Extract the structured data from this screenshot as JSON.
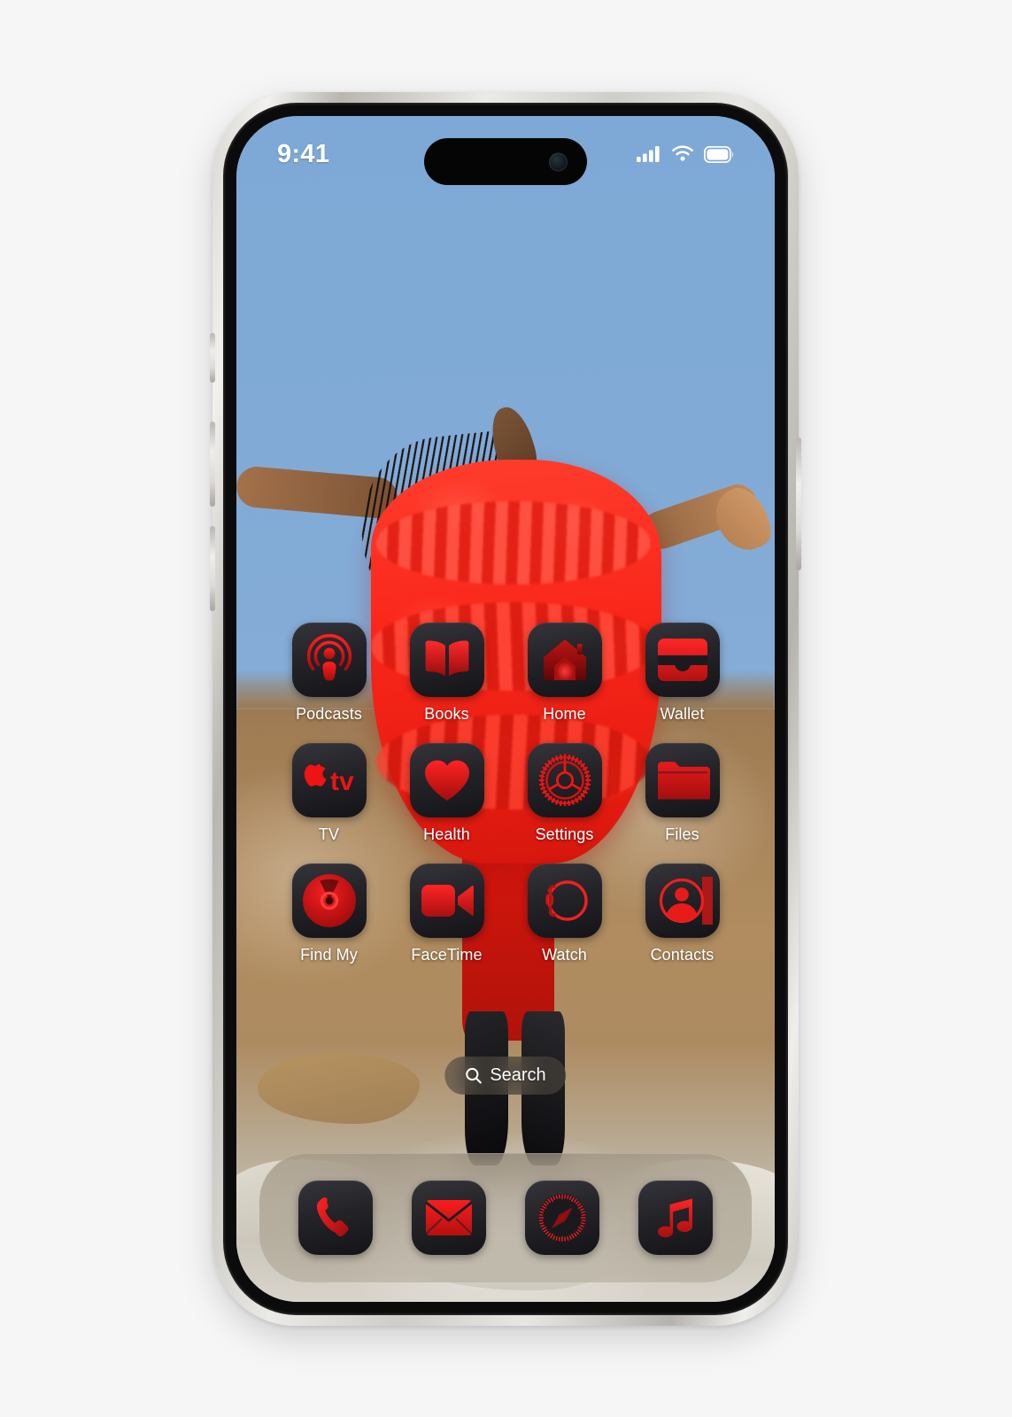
{
  "device": {
    "name": "iPhone",
    "frame_color": "#d8d6d2",
    "screen_background": "#7ba7d7"
  },
  "status_bar": {
    "time": "9:41",
    "signal_icon": "cellular-signal-icon",
    "signal_bars": 4,
    "wifi_icon": "wifi-icon",
    "battery_icon": "battery-icon",
    "battery_full": true,
    "dynamic_island": "dynamic-island",
    "camera_icon": "front-camera-icon"
  },
  "theme": {
    "accent_red": "#ee1111",
    "icon_dark": "#1d1d22",
    "label_color": "#ffffff"
  },
  "home_screen": {
    "rows": [
      [
        {
          "label": "Podcasts",
          "icon": "podcasts-icon"
        },
        {
          "label": "Books",
          "icon": "books-icon"
        },
        {
          "label": "Home",
          "icon": "home-icon"
        },
        {
          "label": "Wallet",
          "icon": "wallet-icon"
        }
      ],
      [
        {
          "label": "TV",
          "icon": "apple-tv-icon"
        },
        {
          "label": "Health",
          "icon": "health-icon"
        },
        {
          "label": "Settings",
          "icon": "settings-icon"
        },
        {
          "label": "Files",
          "icon": "files-icon"
        }
      ],
      [
        {
          "label": "Find My",
          "icon": "find-my-icon"
        },
        {
          "label": "FaceTime",
          "icon": "facetime-icon"
        },
        {
          "label": "Watch",
          "icon": "watch-icon"
        },
        {
          "label": "Contacts",
          "icon": "contacts-icon"
        }
      ]
    ]
  },
  "search": {
    "label": "Search",
    "icon": "search-icon"
  },
  "dock": {
    "items": [
      {
        "label": "Phone",
        "icon": "phone-icon"
      },
      {
        "label": "Mail",
        "icon": "mail-icon"
      },
      {
        "label": "Safari",
        "icon": "safari-icon"
      },
      {
        "label": "Music",
        "icon": "music-icon"
      }
    ]
  },
  "wallpaper": {
    "description": "Woman in red ruffled dress on rocky desert terrain under blue sky",
    "sky_color": "#7ea9d6",
    "dress_color": "#f9261a",
    "rock_color": "#a9855b"
  },
  "side_buttons": [
    {
      "name": "action-button"
    },
    {
      "name": "volume-up-button"
    },
    {
      "name": "volume-down-button"
    },
    {
      "name": "power-button"
    }
  ]
}
